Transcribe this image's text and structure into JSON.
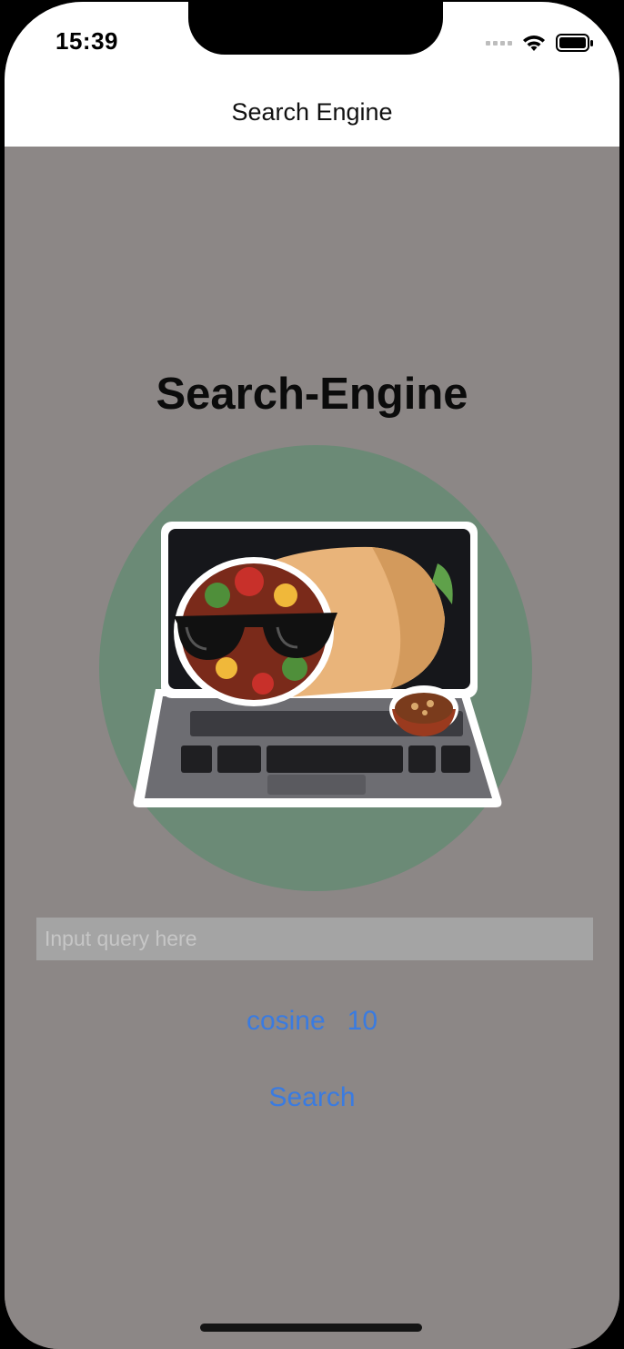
{
  "status_bar": {
    "time": "15:39"
  },
  "nav": {
    "title": "Search Engine"
  },
  "main": {
    "heading": "Search-Engine",
    "logo_icon": "burrito-with-sunglasses-on-laptop",
    "query_placeholder": "Input query here",
    "query_value": "",
    "similarity_option": "cosine",
    "result_count_option": "10",
    "search_label": "Search"
  },
  "colors": {
    "background": "#8c8786",
    "bars": "#ffffff",
    "accent_link": "#3a7be0",
    "logo_circle": "#6b8a76"
  }
}
